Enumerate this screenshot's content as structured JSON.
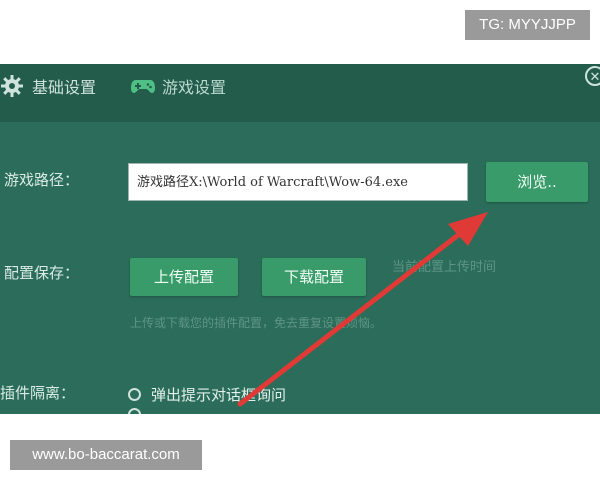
{
  "watermarks": {
    "top": "TG: MYYJJPP",
    "bottom": "www.bo-baccarat.com"
  },
  "tabs": [
    {
      "label": "基础设置",
      "icon": "gear-icon"
    },
    {
      "label": "游戏设置",
      "icon": "gamepad-icon"
    }
  ],
  "form": {
    "path_label": "游戏路径：",
    "path_value": "游戏路径X:\\World of Warcraft\\Wow-64.exe",
    "browse_label": "浏览..",
    "config_label": "配置保存：",
    "upload_label": "上传配置",
    "download_label": "下载配置",
    "upload_time_hint": "当前配置上传时间",
    "config_hint": "上传或下载您的插件配置，免去重复设置烦恼。",
    "isolate_label": "插件隔离：",
    "radio_option_1": "弹出提示对话框询问"
  },
  "colors": {
    "window_bg": "#2b6d5a",
    "button": "#3a9b6a",
    "arrow": "#e03a36"
  }
}
